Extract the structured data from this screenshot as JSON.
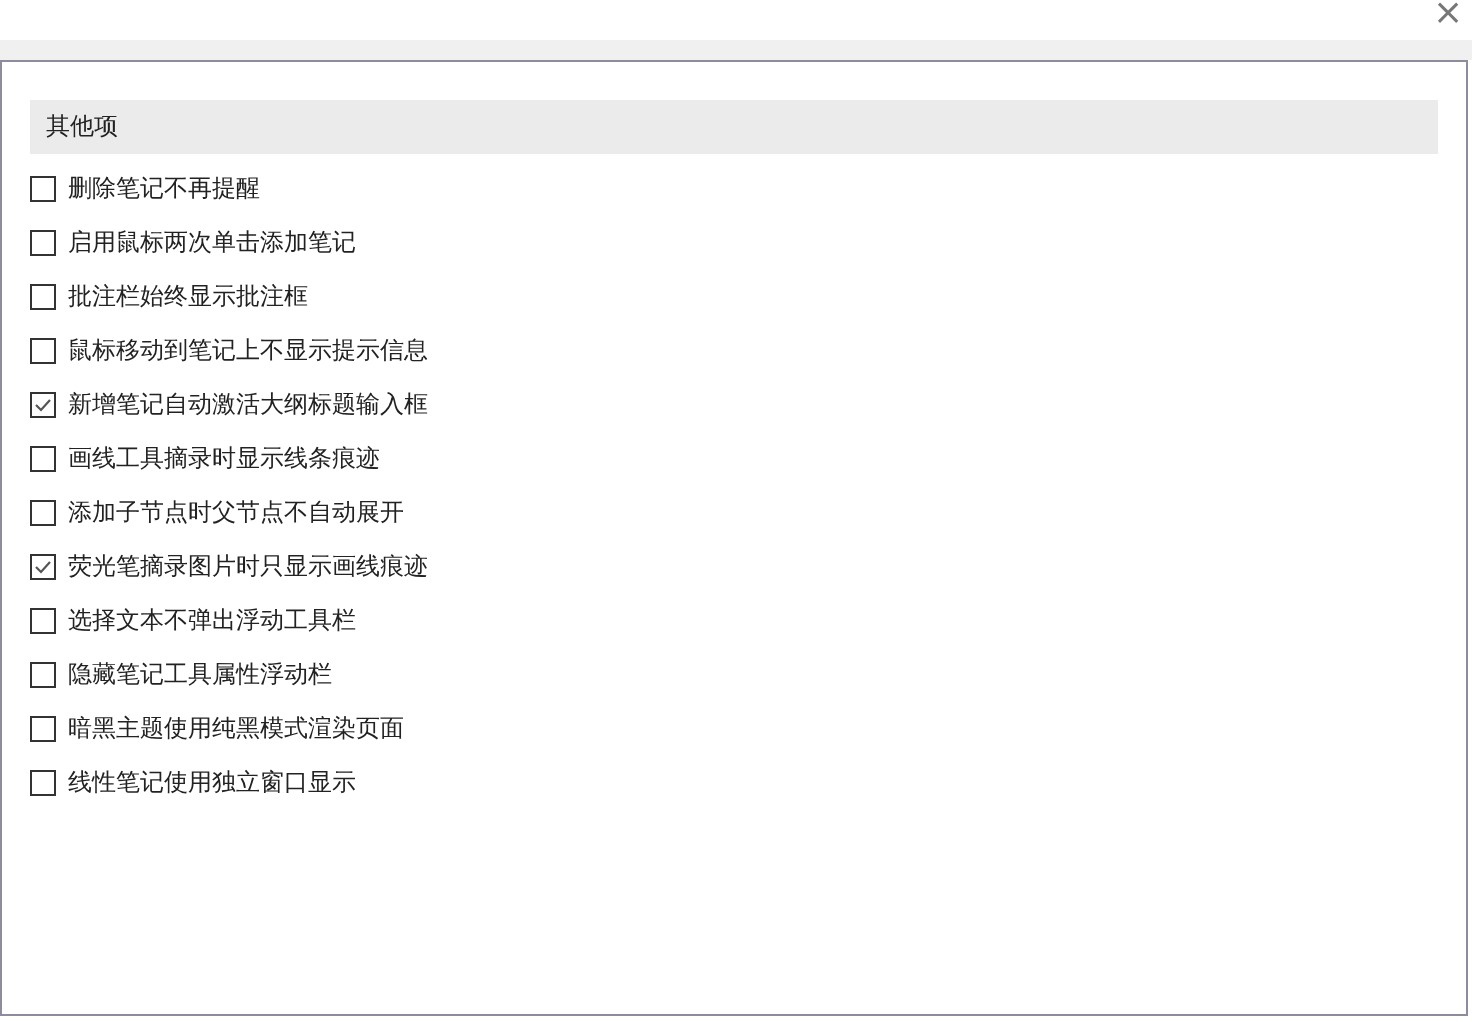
{
  "window": {
    "close": "×"
  },
  "section": {
    "title": "其他项"
  },
  "options": [
    {
      "label": "删除笔记不再提醒",
      "checked": false
    },
    {
      "label": "启用鼠标两次单击添加笔记",
      "checked": false
    },
    {
      "label": "批注栏始终显示批注框",
      "checked": false
    },
    {
      "label": "鼠标移动到笔记上不显示提示信息",
      "checked": false
    },
    {
      "label": "新增笔记自动激活大纲标题输入框",
      "checked": true
    },
    {
      "label": "画线工具摘录时显示线条痕迹",
      "checked": false
    },
    {
      "label": "添加子节点时父节点不自动展开",
      "checked": false
    },
    {
      "label": "荧光笔摘录图片时只显示画线痕迹",
      "checked": true
    },
    {
      "label": "选择文本不弹出浮动工具栏",
      "checked": false
    },
    {
      "label": "隐藏笔记工具属性浮动栏",
      "checked": false
    },
    {
      "label": "暗黑主题使用纯黑模式渲染页面",
      "checked": false
    },
    {
      "label": "线性笔记使用独立窗口显示",
      "checked": false
    }
  ]
}
